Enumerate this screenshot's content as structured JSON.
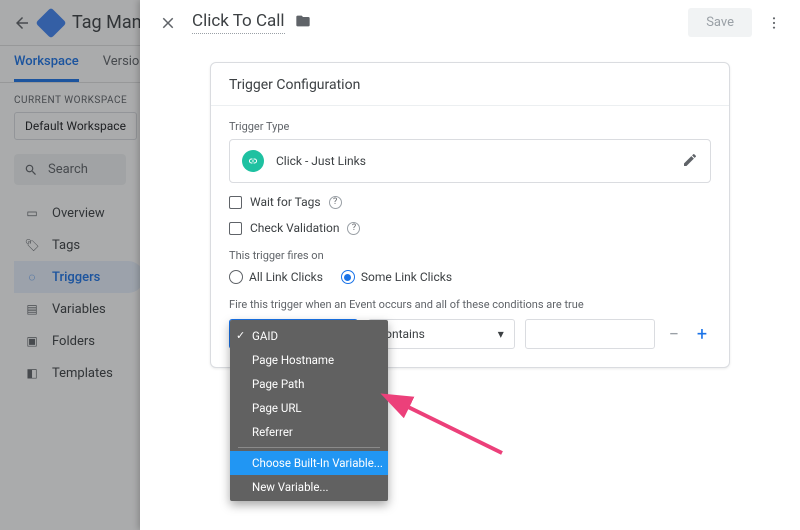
{
  "app_title": "Tag Manag",
  "tabs": {
    "workspace": "Workspace",
    "versions": "Versions"
  },
  "workspace_label": "CURRENT WORKSPACE",
  "workspace_name": "Default Workspace",
  "search_placeholder": "Search",
  "nav": {
    "overview": "Overview",
    "tags": "Tags",
    "triggers": "Triggers",
    "variables": "Variables",
    "folders": "Folders",
    "templates": "Templates"
  },
  "panel": {
    "title": "Click To Call",
    "save": "Save",
    "card_title": "Trigger Configuration",
    "type_label": "Trigger Type",
    "type_value": "Click - Just Links",
    "wait_tags": "Wait for Tags",
    "check_validation": "Check Validation",
    "fires_label": "This trigger fires on",
    "radio_all": "All Link Clicks",
    "radio_some": "Some Link Clicks",
    "cond_label": "Fire this trigger when an Event occurs and all of these conditions are true",
    "op_value": "contains"
  },
  "dropdown": {
    "items": [
      "GAID",
      "Page Hostname",
      "Page Path",
      "Page URL",
      "Referrer"
    ],
    "builtin": "Choose Built-In Variable...",
    "newvar": "New Variable..."
  }
}
